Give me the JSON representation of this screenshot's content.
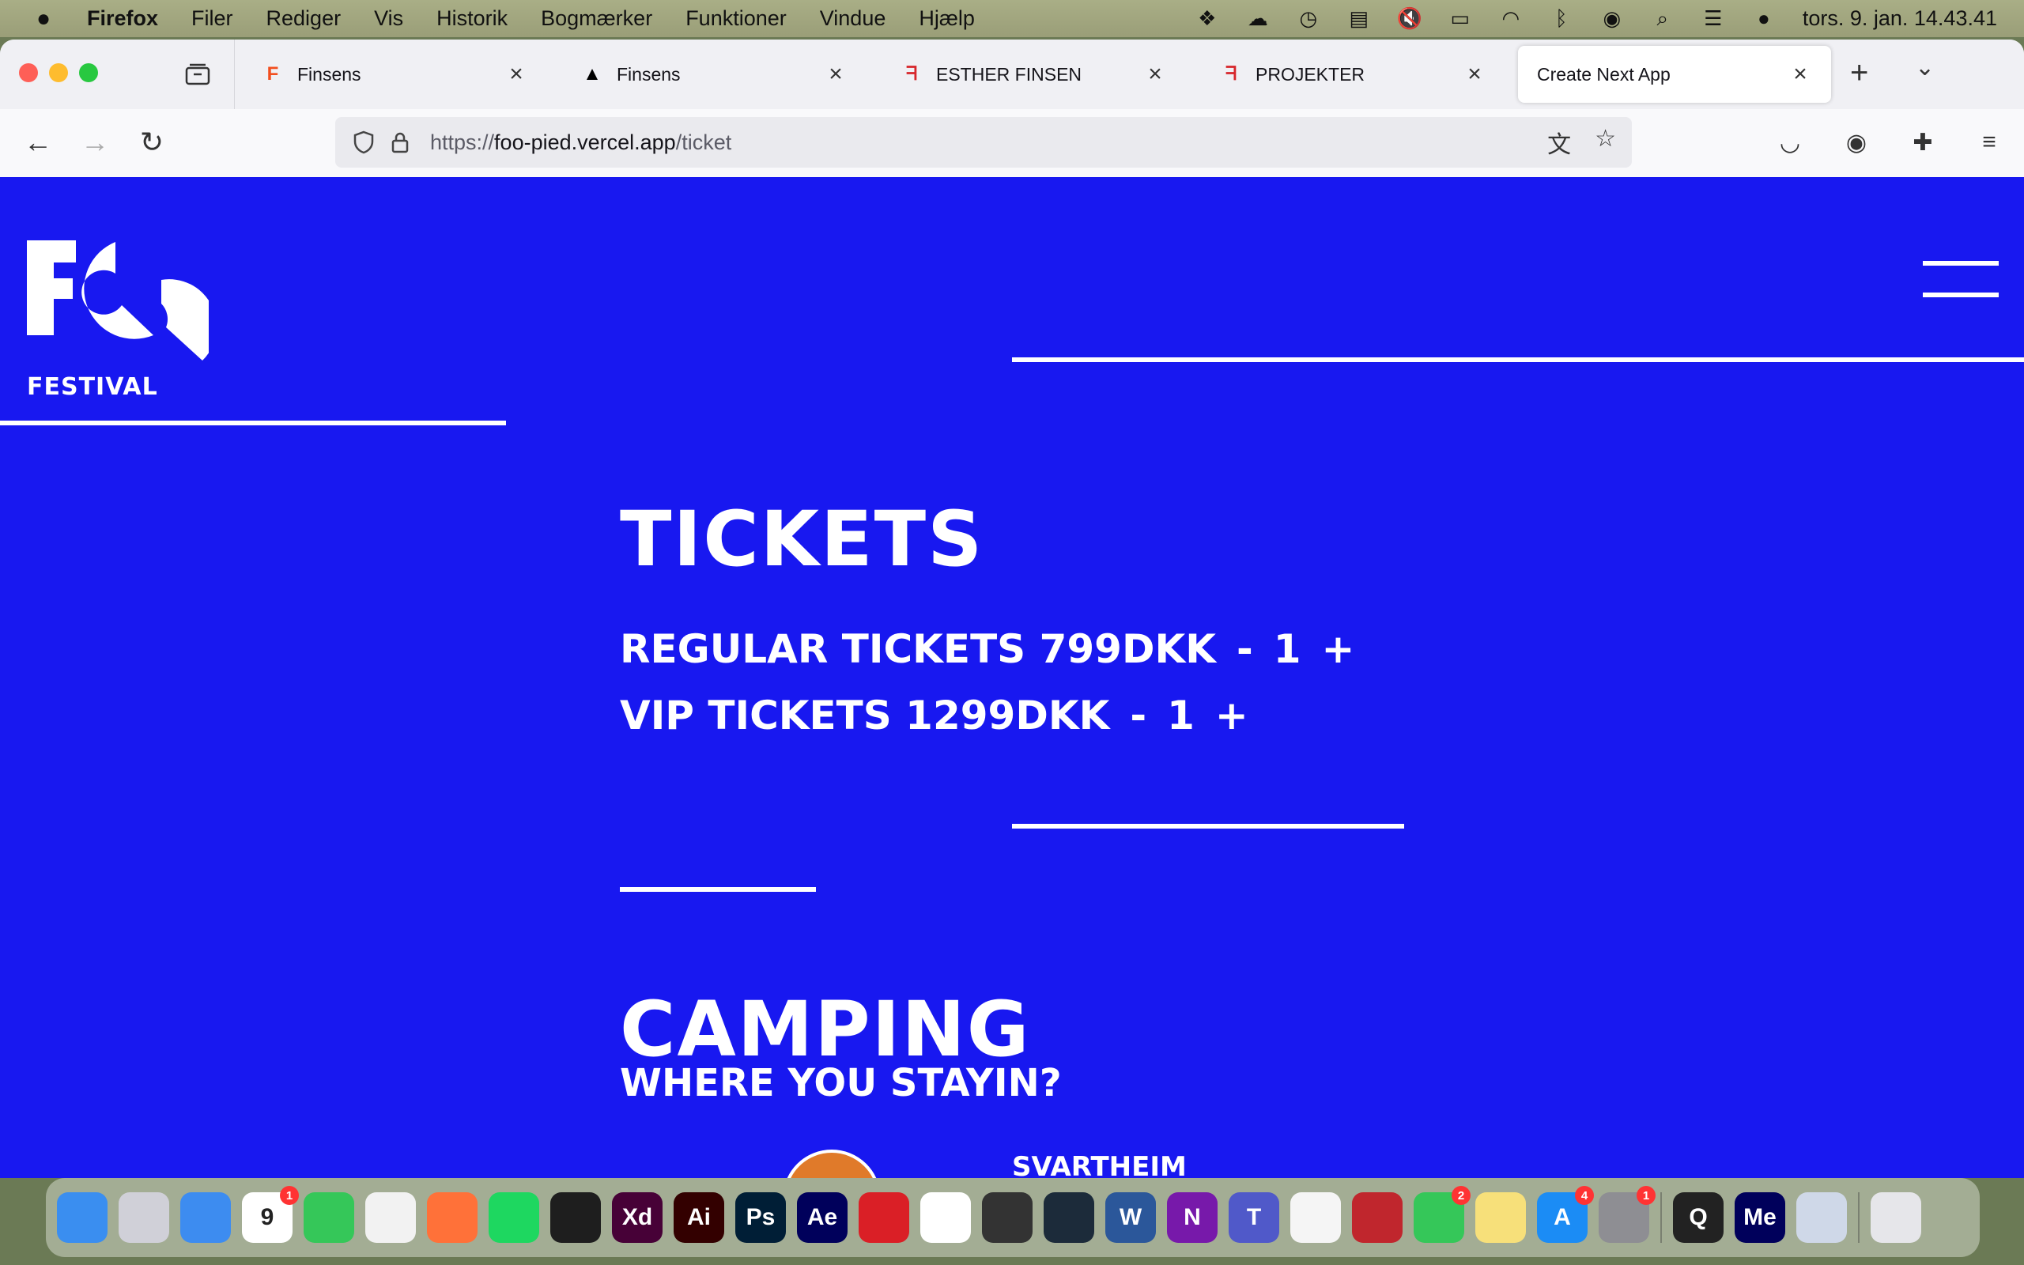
{
  "menubar": {
    "app_name": "Firefox",
    "items": [
      "Filer",
      "Rediger",
      "Vis",
      "Historik",
      "Bogmærker",
      "Funktioner",
      "Vindue",
      "Hjælp"
    ],
    "clock": "tors. 9. jan.  14.43.41"
  },
  "tabs": [
    {
      "title": "Finsens",
      "favicon": "F"
    },
    {
      "title": "Finsens",
      "favicon": "▲"
    },
    {
      "title": "ESTHER FINSEN",
      "favicon": "ᖷ"
    },
    {
      "title": "PROJEKTER",
      "favicon": "ᖷ"
    },
    {
      "title": "Create Next App",
      "favicon": ""
    }
  ],
  "url": {
    "scheme": "https://",
    "host": "foo-pied.vercel.app",
    "path": "/ticket"
  },
  "site": {
    "logo_text": "FESTIVAL",
    "tickets_heading": "TICKETS",
    "regular": {
      "label": "REGULAR TICKETS 799DKK",
      "minus": "-",
      "qty": "1",
      "plus": "+"
    },
    "vip": {
      "label": "VIP TICKETS 1299DKK",
      "minus": "-",
      "qty": "1",
      "plus": "+"
    },
    "camping_heading": "CAMPING",
    "camping_sub": "WHERE YOU STAYIN?",
    "camp_option": "SVARTHEIM"
  },
  "colors": {
    "page_bg": "#1818f0",
    "text": "#ffffff",
    "camp_dot": "#e07a2a"
  },
  "dock": [
    {
      "name": "finder-icon",
      "label": "",
      "color": "#3a8ef0"
    },
    {
      "name": "launchpad-icon",
      "label": "",
      "color": "#d0d0d8"
    },
    {
      "name": "mail-icon",
      "label": "",
      "color": "#3d8cf0"
    },
    {
      "name": "calendar-icon",
      "label": "9",
      "color": "#ffffff",
      "badge": "1"
    },
    {
      "name": "messages-icon",
      "label": "",
      "color": "#35c759"
    },
    {
      "name": "chrome-icon",
      "label": "",
      "color": "#f2f2f2"
    },
    {
      "name": "firefox-icon",
      "label": "",
      "color": "#ff7139"
    },
    {
      "name": "spotify-icon",
      "label": "",
      "color": "#1ed760"
    },
    {
      "name": "figma-icon",
      "label": "",
      "color": "#1e1e1e"
    },
    {
      "name": "xd-icon",
      "label": "Xd",
      "color": "#470137"
    },
    {
      "name": "illustrator-icon",
      "label": "Ai",
      "color": "#330000"
    },
    {
      "name": "photoshop-icon",
      "label": "Ps",
      "color": "#001e36"
    },
    {
      "name": "after-effects-icon",
      "label": "Ae",
      "color": "#00005b"
    },
    {
      "name": "creative-cloud-icon",
      "label": "",
      "color": "#da1f26"
    },
    {
      "name": "vscode-icon",
      "label": "",
      "color": "#ffffff"
    },
    {
      "name": "compass-icon",
      "label": "",
      "color": "#333333"
    },
    {
      "name": "testflight-icon",
      "label": "",
      "color": "#1c2b3a"
    },
    {
      "name": "word-icon",
      "label": "W",
      "color": "#2b579a"
    },
    {
      "name": "onenote-icon",
      "label": "N",
      "color": "#7719aa"
    },
    {
      "name": "teams-icon",
      "label": "T",
      "color": "#5059c9"
    },
    {
      "name": "photos-icon",
      "label": "",
      "color": "#f5f5f5"
    },
    {
      "name": "photo-booth-icon",
      "label": "",
      "color": "#c0262d"
    },
    {
      "name": "facetime-icon",
      "label": "",
      "color": "#35c759",
      "badge": "2"
    },
    {
      "name": "notes-icon",
      "label": "",
      "color": "#f7e07a"
    },
    {
      "name": "app-store-icon",
      "label": "A",
      "color": "#1b8cf5",
      "badge": "4"
    },
    {
      "name": "system-settings-icon",
      "label": "",
      "color": "#8e8e93",
      "badge": "1"
    },
    {
      "name": "quicktime-icon",
      "label": "Q",
      "color": "#222222"
    },
    {
      "name": "media-encoder-icon",
      "label": "Me",
      "color": "#00005b"
    },
    {
      "name": "preview-icon",
      "label": "",
      "color": "#cfd8e8"
    },
    {
      "name": "trash-icon",
      "label": "",
      "color": "#e6e6ea"
    }
  ]
}
